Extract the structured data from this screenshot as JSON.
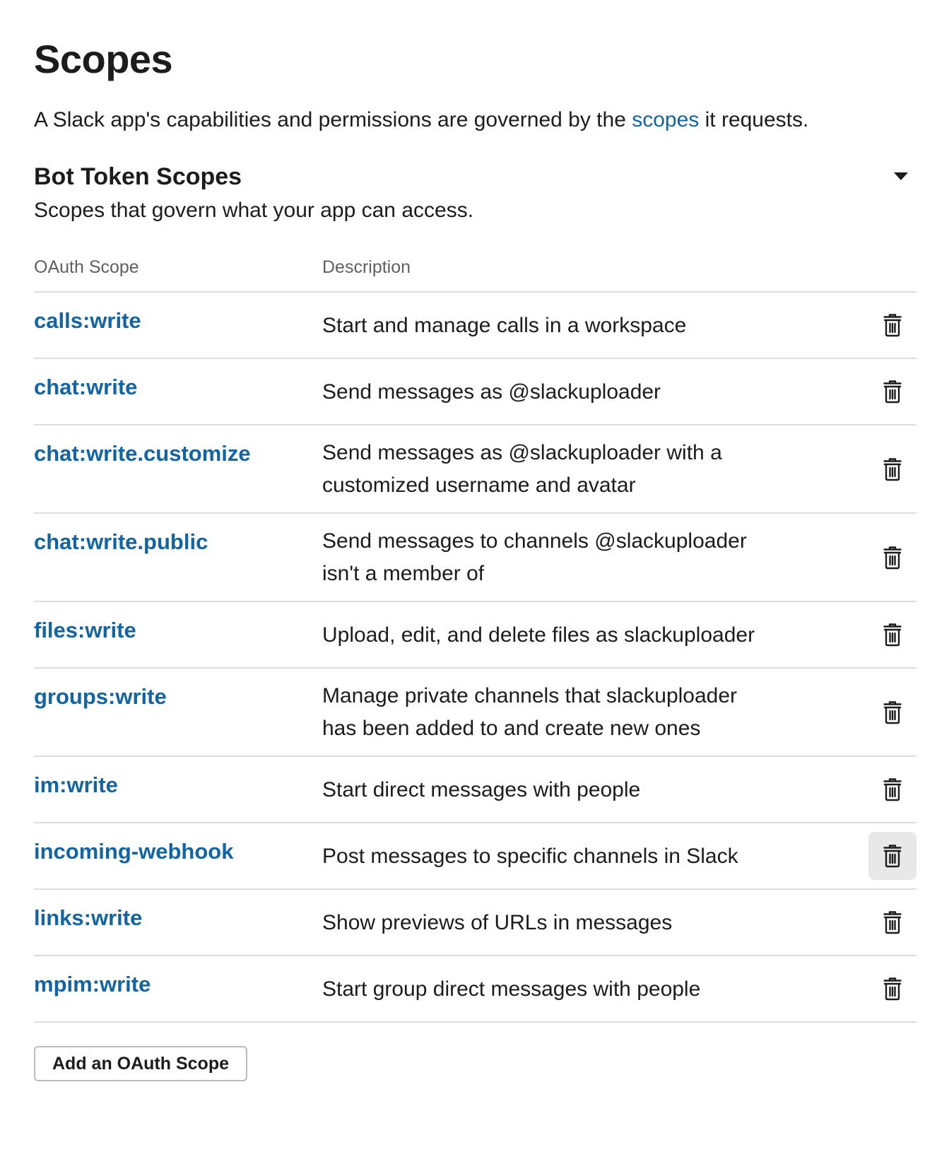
{
  "page": {
    "title": "Scopes",
    "intro_before": "A Slack app's capabilities and permissions are governed by the ",
    "intro_link": "scopes",
    "intro_after": " it requests."
  },
  "section": {
    "title": "Bot Token Scopes",
    "subtitle": "Scopes that govern what your app can access."
  },
  "table": {
    "col_scope": "OAuth Scope",
    "col_description": "Description",
    "rows": [
      {
        "scope": "calls:write",
        "description": "Start and manage calls in a workspace",
        "lines": 1,
        "hovered": false
      },
      {
        "scope": "chat:write",
        "description": "Send messages as @slackuploader",
        "lines": 1,
        "hovered": false
      },
      {
        "scope": "chat:write.customize",
        "description": "Send messages as @slackuploader with a customized username and avatar",
        "lines": 2,
        "hovered": false
      },
      {
        "scope": "chat:write.public",
        "description": "Send messages to channels @slackuploader isn't a member of",
        "lines": 2,
        "hovered": false
      },
      {
        "scope": "files:write",
        "description": "Upload, edit, and delete files as slackuploader",
        "lines": 1,
        "hovered": false
      },
      {
        "scope": "groups:write",
        "description": "Manage private channels that slackuploader has been added to and create new ones",
        "lines": 2,
        "hovered": false
      },
      {
        "scope": "im:write",
        "description": "Start direct messages with people",
        "lines": 1,
        "hovered": false
      },
      {
        "scope": "incoming-webhook",
        "description": "Post messages to specific channels in Slack",
        "lines": 1,
        "hovered": true
      },
      {
        "scope": "links:write",
        "description": "Show previews of URLs in messages",
        "lines": 1,
        "hovered": false
      },
      {
        "scope": "mpim:write",
        "description": "Start group direct messages with people",
        "lines": 1,
        "hovered": false
      }
    ]
  },
  "actions": {
    "add_scope_label": "Add an OAuth Scope"
  },
  "colors": {
    "link": "#1264a3",
    "text": "#1d1c1d",
    "muted": "#616061",
    "divider": "#dddddd",
    "hover_bg": "#e8e8e8"
  },
  "icons": {
    "delete": "trash-icon",
    "collapse": "caret-down-icon"
  }
}
